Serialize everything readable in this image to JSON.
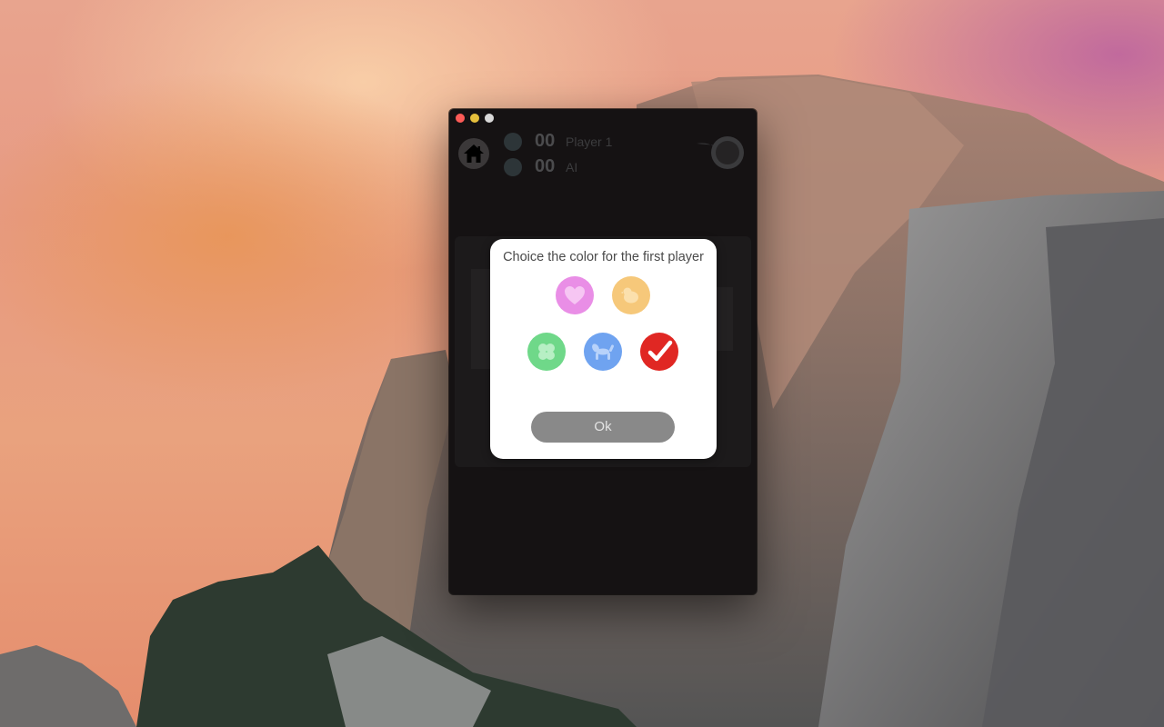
{
  "window": {
    "controls": [
      "close",
      "minimize",
      "zoom"
    ]
  },
  "game": {
    "players": [
      {
        "score": "00",
        "name": "Player 1"
      },
      {
        "score": "00",
        "name": "AI"
      }
    ],
    "icons": {
      "home": "home-icon",
      "timer": "clock-icon",
      "restart": "restart-icon"
    }
  },
  "dialog": {
    "title": "Choice the color for the first player",
    "ok_label": "Ok",
    "options": [
      {
        "name": "heart",
        "color": "#e98ee6",
        "icon": "heart-icon",
        "selected": false
      },
      {
        "name": "chick",
        "color": "#f6c87a",
        "icon": "chick-icon",
        "selected": false
      },
      {
        "name": "clover",
        "color": "#6fd889",
        "icon": "clover-icon",
        "selected": false
      },
      {
        "name": "balloon-dog",
        "color": "#6fa3f0",
        "icon": "balloon-dog-icon",
        "selected": false
      },
      {
        "name": "red",
        "color": "#e02723",
        "icon": "checkmark-icon",
        "selected": true
      }
    ]
  }
}
